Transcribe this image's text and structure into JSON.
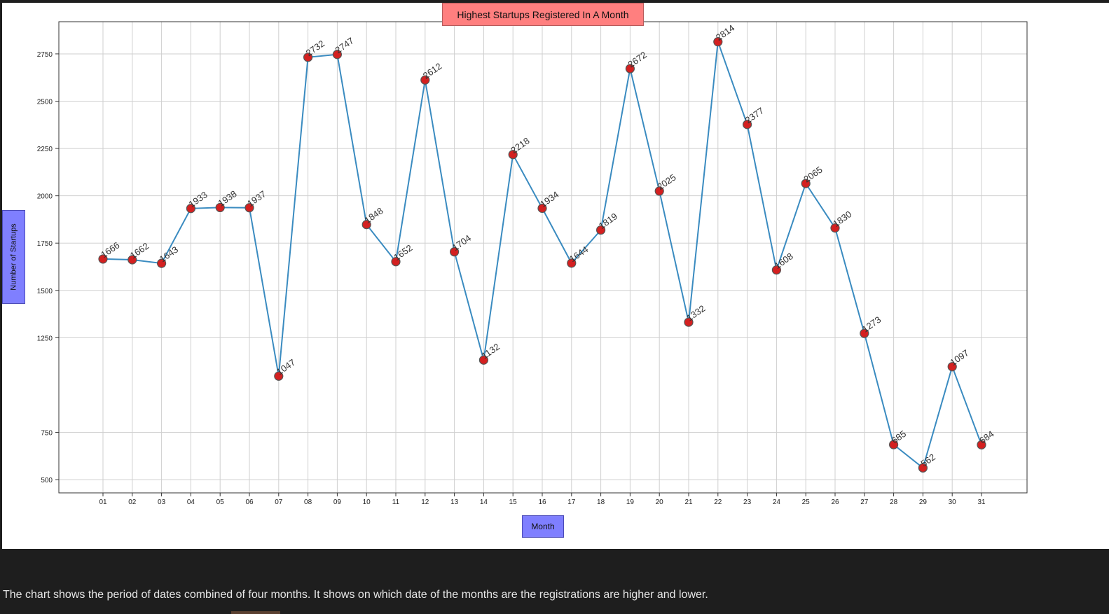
{
  "caption": "The chart shows the period of dates combined of four months. It shows on which date of the months are the registrations are higher and lower.",
  "colors": {
    "line": "#3a8bc0",
    "marker_fill": "#d42020",
    "marker_edge": "#555555",
    "title_bg": "#ff7f7f",
    "label_bg": "#7f7fff",
    "grid": "#cfcfcf"
  },
  "chart_data": {
    "type": "line",
    "title": "Highest Startups Registered In A Month",
    "xlabel": "Month",
    "ylabel": "Number of Startups",
    "categories": [
      "01",
      "02",
      "03",
      "04",
      "05",
      "06",
      "07",
      "08",
      "09",
      "10",
      "11",
      "12",
      "13",
      "14",
      "15",
      "16",
      "17",
      "18",
      "19",
      "20",
      "21",
      "22",
      "23",
      "24",
      "25",
      "26",
      "27",
      "28",
      "29",
      "30",
      "31"
    ],
    "series": [
      {
        "values": [
          1666,
          1662,
          1643,
          1933,
          1938,
          1937,
          1047,
          2732,
          2747,
          1848,
          1652,
          2612,
          1704,
          1132,
          2218,
          1934,
          1644,
          1819,
          2672,
          2025,
          1332,
          2814,
          2377,
          1608,
          2065,
          1830,
          1273,
          685,
          562,
          1097,
          684
        ]
      }
    ],
    "yticks": [
      500,
      750,
      1250,
      1500,
      1750,
      2000,
      2250,
      2500,
      2750
    ],
    "ylim": [
      430,
      2920
    ],
    "grid": true,
    "data_labels": true
  }
}
